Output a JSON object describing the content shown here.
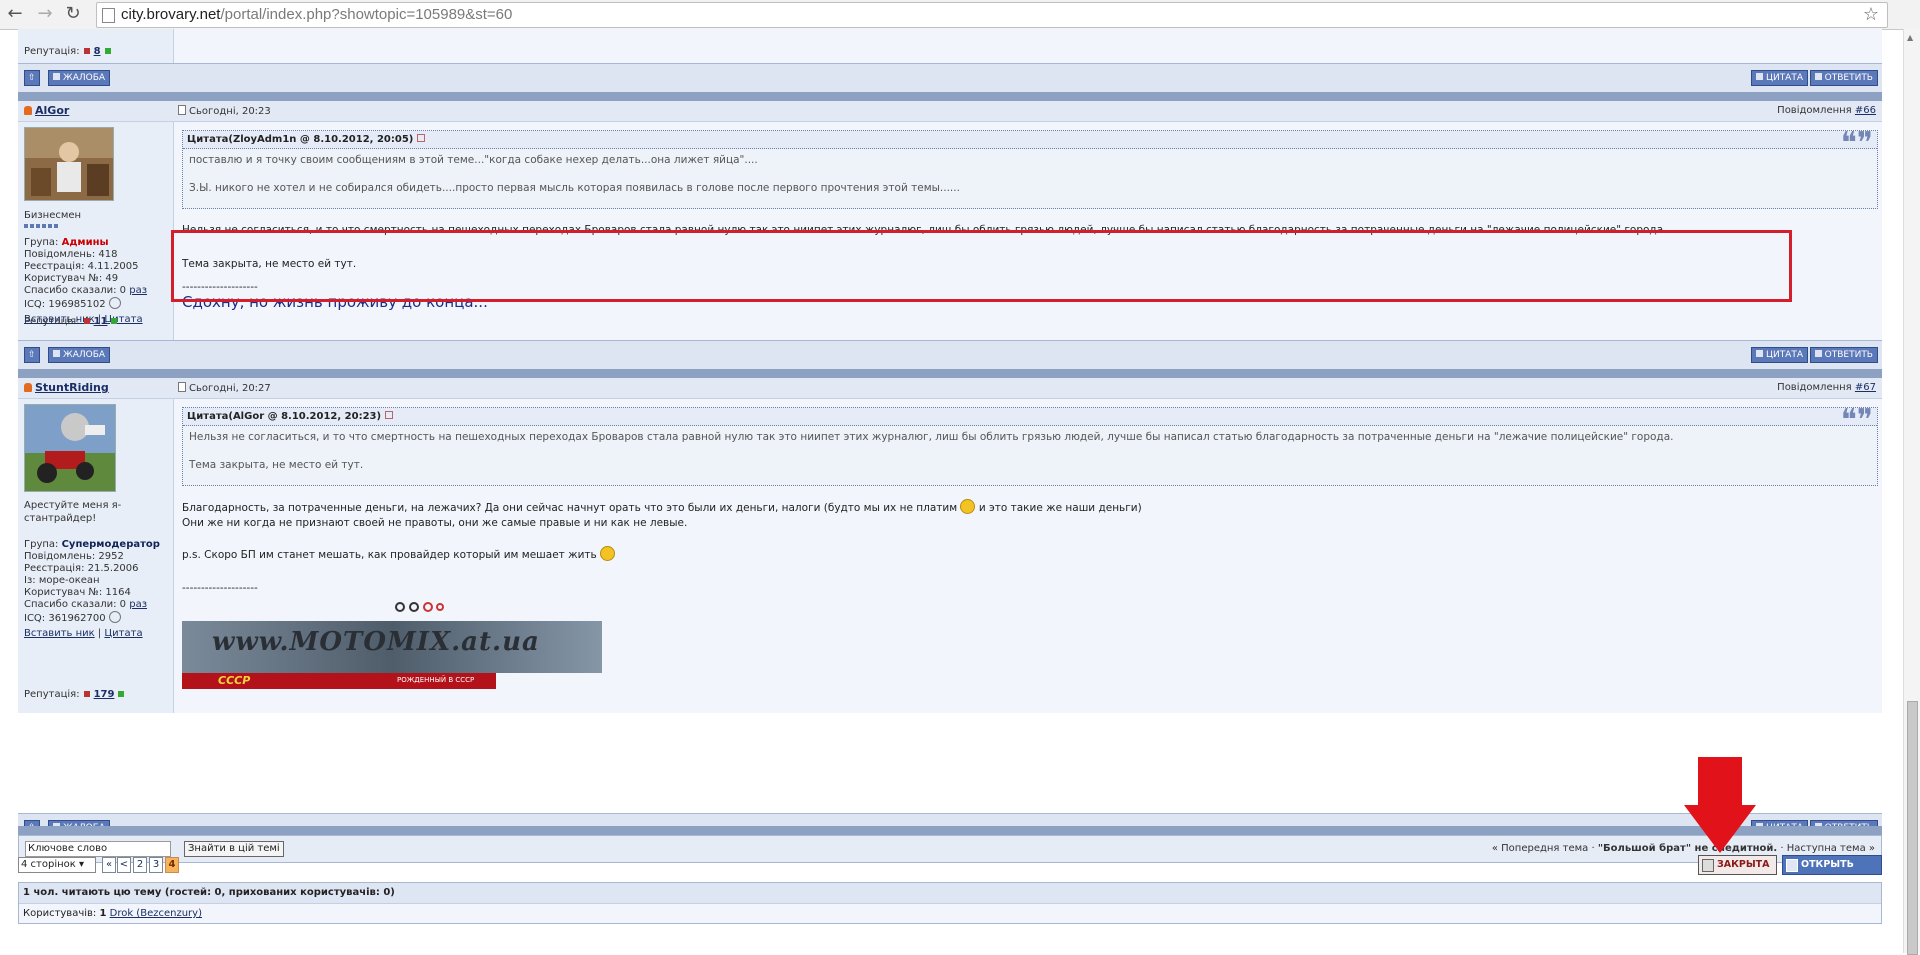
{
  "browser": {
    "url_host": "city.brovary.net",
    "url_path": "/portal/index.php?showtopic=105989&st=60"
  },
  "prev_post": {
    "reputation_label": "Репутація:",
    "reputation_value": "8",
    "report_label": "ЖАЛОБА",
    "quote_label": "ЦИТАТА",
    "reply_label": "ОТВЕТИТЬ"
  },
  "post66": {
    "username": "AlGor",
    "date": "Сьогодні, 20:23",
    "post_label": "Повідомлення",
    "post_number": "#66",
    "rank": "Бизнесмен",
    "group_label": "Група:",
    "group_value": "Админы",
    "posts": "Повідомлень: 418",
    "registered": "Реєстрація: 4.11.2005",
    "user_no": "Користувач №: 49",
    "thanks_label": "Спасибо сказали: 0",
    "thanks_link": "раз",
    "icq": "ICQ: 196985102",
    "insert_nick": "Вставить ник",
    "quote_link": "Цитата",
    "reputation_label": "Репутація:",
    "reputation_value": "11",
    "quote_header": "Цитата(ZloyAdm1n @ 8.10.2012, 20:05)",
    "quote_line1": "поставлю и я точку своим сообщениям в этой теме...\"когда собаке нехер делать...она лижет яйца\"....",
    "quote_line2": "З.Ы. никого не хотел и не собирался обидеть....просто первая мысль которая появилась в голове после первого прочтения этой темы......",
    "body_line1": "Нельзя не согласиться, и то что смертность на пешеходных переходах Броваров стала равной нулю так это ниипет этих журналюг, лиш бы облить грязью людей, лучше бы написал статью благодарность за потраченные деньги на \"лежачие полицейские\" города.",
    "body_line2": "Тема закрыта, не место ей тут.",
    "sig_sep": "--------------------",
    "signature": "Сдохну, но жизнь проживу до конца...",
    "report_label": "ЖАЛОБА",
    "quote_label": "ЦИТАТА",
    "reply_label": "ОТВЕТИТЬ"
  },
  "post67": {
    "username": "StuntRiding",
    "date": "Сьогодні, 20:27",
    "post_label": "Повідомлення",
    "post_number": "#67",
    "title_line1": "Арестуйте меня я-",
    "title_line2": "стантрайдер!",
    "group_label": "Група:",
    "group_value": "Супермодератор",
    "posts": "Повідомлень: 2952",
    "registered": "Реєстрація: 21.5.2006",
    "from": "Із: море-океан",
    "user_no": "Користувач №: 1164",
    "thanks_label": "Спасибо сказали: 0",
    "thanks_link": "раз",
    "icq": "ICQ: 361962700",
    "insert_nick": "Вставить ник",
    "quote_link": "Цитата",
    "reputation_label": "Репутація:",
    "reputation_value": "179",
    "quote_header": "Цитата(AlGor @ 8.10.2012, 20:23)",
    "quote_line1": "Нельзя не согласиться, и то что смертность на пешеходных переходах Броваров стала равной нулю так это ниипет этих журналюг, лиш бы облить грязью людей, лучше бы написал статью благодарность за потраченные деньги на \"лежачие полицейские\" города.",
    "quote_line2": "Тема закрыта, не место ей тут.",
    "body_line1a": "Благодарность, за потраченные деньги, на лежачих? Да они сейчас начнут орать что это были их деньги, налоги (будто мы их не платим",
    "body_line1b": "и это такие же наши деньги)",
    "body_line2": "Они же ни когда не признают своей не правоты, они же самые правые и ни как не левые.",
    "body_line3": "p.s. Скоро БП им станет мешать, как провайдер который им мешает жить",
    "sig_sep": "--------------------",
    "banner_text": "www.MOTOMIX.at.ua",
    "banner_sub_left": "CCCP",
    "banner_sub_right": "РОЖДЕННЫЙ В СССР",
    "report_label": "ЖАЛОБА",
    "quote_label": "ЦИТАТА",
    "reply_label": "ОТВЕТИТЬ"
  },
  "search": {
    "keyword_value": "Ключове слово",
    "find_button": "Знайти в цій темі",
    "nav_prev": "« Попередня тема",
    "nav_sep": "·",
    "nav_current": "\"Большой брат\" не следит",
    "nav_current_tail": "ной.",
    "nav_next": "Наступна тема »"
  },
  "pagination": {
    "pages_select": "4 сторінок",
    "first": "«",
    "prev": "<",
    "p2": "2",
    "p3": "3",
    "p4": "4"
  },
  "topic_buttons": {
    "closed": "ЗАКРЫТА",
    "open_topic": "ОТКРЫТЬ ТЕМУ"
  },
  "active_users": {
    "header": "1 чол. читають цю тему (гостей: 0, прихованих користувачів: 0)",
    "users_label": "Користувачів:",
    "users_count": "1",
    "user_link": "Drok (Bezcenzury)"
  },
  "colors": {
    "highlight_box": "#d31f2c",
    "arrow": "#e1121a"
  }
}
